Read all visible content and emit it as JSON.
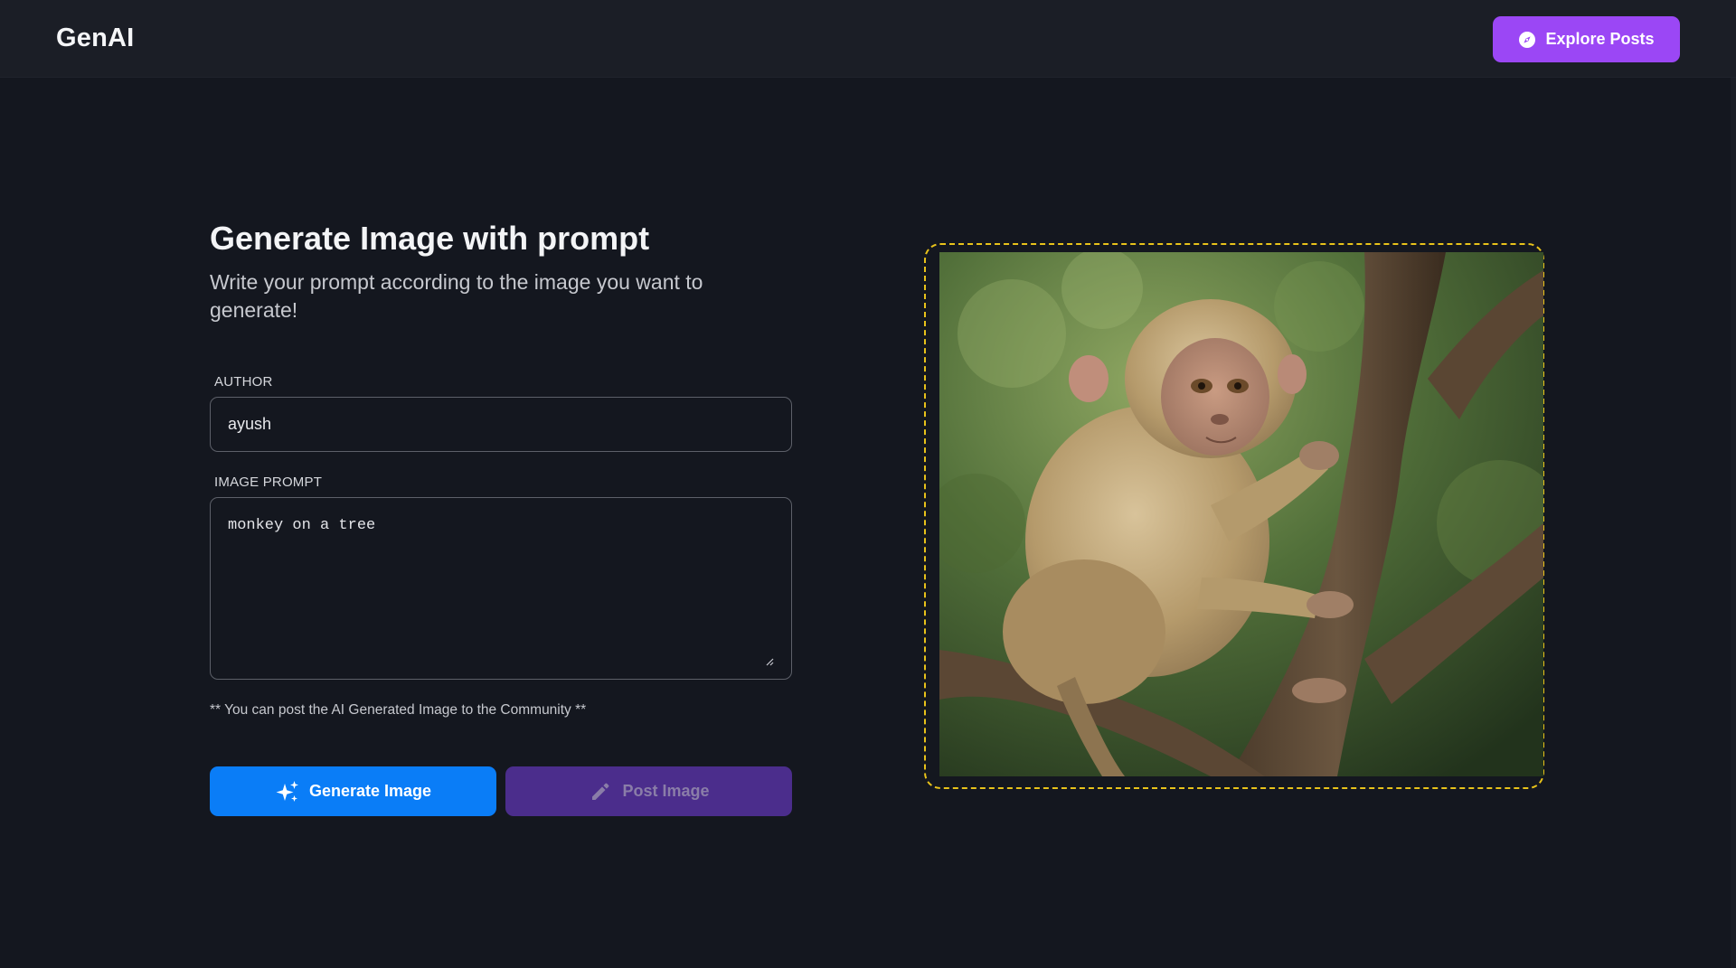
{
  "header": {
    "brand": "GenAI",
    "explore_label": "Explore Posts",
    "explore_icon": "compass-icon"
  },
  "main": {
    "title": "Generate Image with prompt",
    "subtitle": "Write your prompt according to the image you want to generate!",
    "author": {
      "label": "AUTHOR",
      "value": "ayush"
    },
    "prompt": {
      "label": "IMAGE PROMPT",
      "value": "monkey on a tree"
    },
    "note": "** You can post the AI Generated Image to the Community **",
    "generate_label": "Generate Image",
    "generate_icon": "sparkles-icon",
    "post_label": "Post Image",
    "post_icon": "pencil-icon"
  },
  "preview": {
    "image_subject": "monkey sitting on a tree branch in a forest",
    "frame_color": "#e8c21a"
  },
  "colors": {
    "background": "#14171f",
    "navbar": "#1b1e26",
    "accent_purple": "#9b47f5",
    "generate_blue": "#0a7df7",
    "post_purple_disabled": "#4b2d8c"
  }
}
